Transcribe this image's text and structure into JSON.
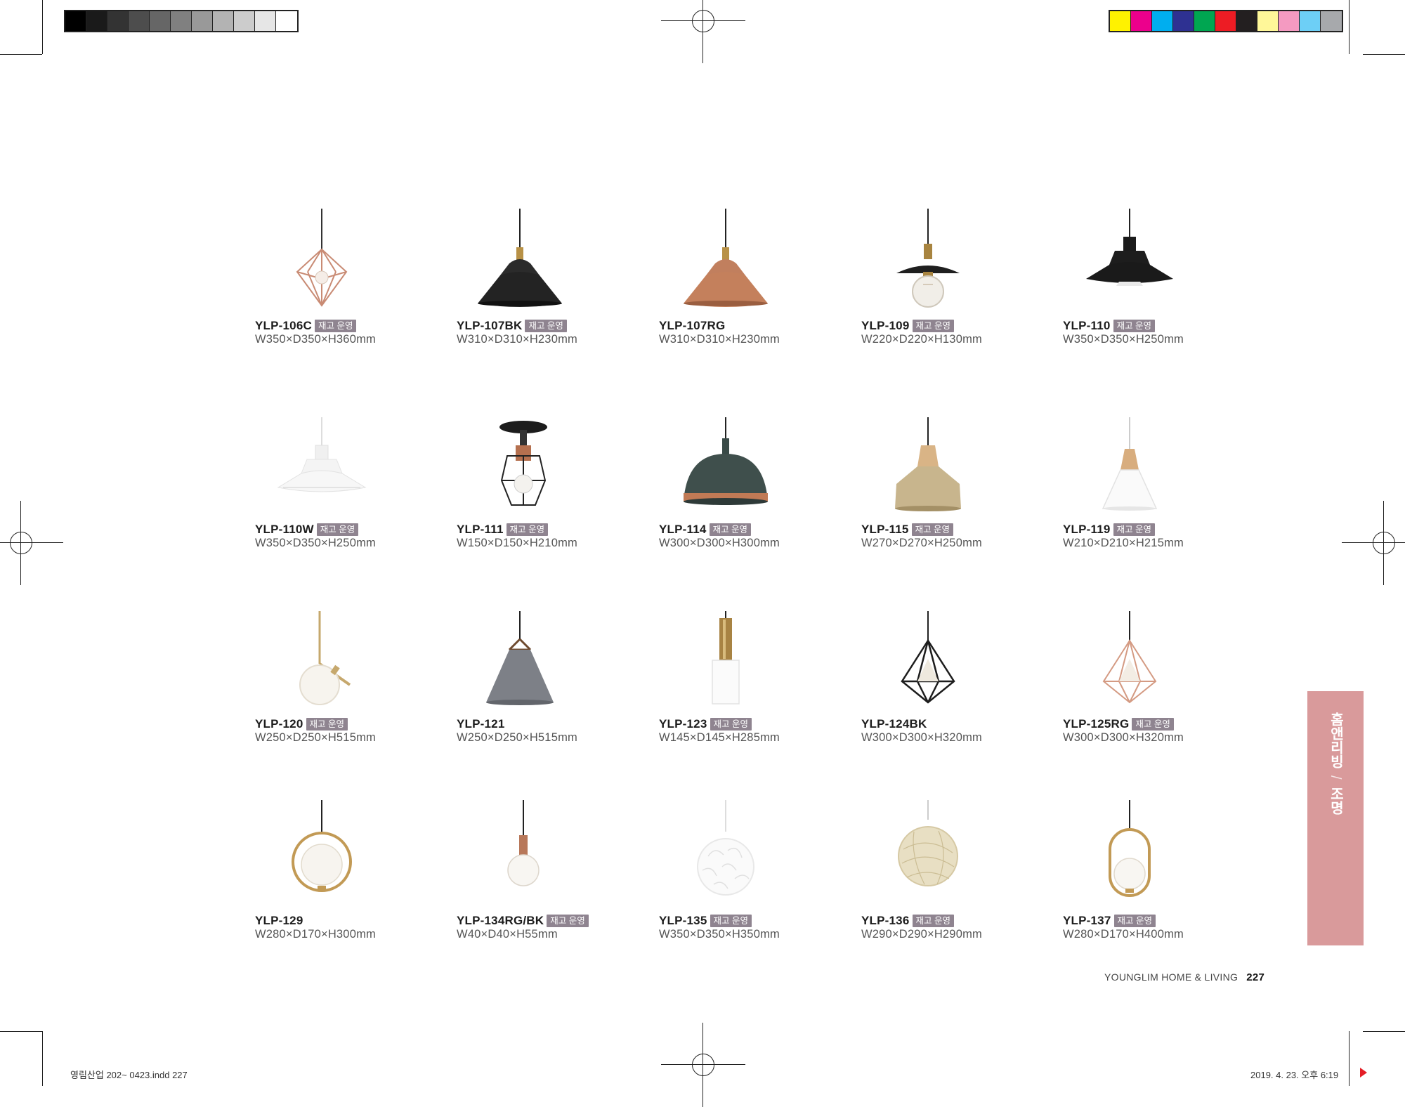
{
  "products": [
    {
      "code": "YLP-106C",
      "badge": "재고 운영",
      "dims": "W350×D350×H360mm",
      "icon": "geometric-cage-pendant-icon"
    },
    {
      "code": "YLP-107BK",
      "badge": "재고 운영",
      "dims": "W310×D310×H230mm",
      "icon": "black-dome-pendant-icon"
    },
    {
      "code": "YLP-107RG",
      "badge": "",
      "dims": "W310×D310×H230mm",
      "icon": "copper-dome-pendant-icon"
    },
    {
      "code": "YLP-109",
      "badge": "재고 운영",
      "dims": "W220×D220×H130mm",
      "icon": "flat-shade-bulb-pendant-icon"
    },
    {
      "code": "YLP-110",
      "badge": "재고 운영",
      "dims": "W350×D350×H250mm",
      "icon": "black-tiered-pendant-icon"
    },
    {
      "code": "YLP-110W",
      "badge": "재고 운영",
      "dims": "W350×D350×H250mm",
      "icon": "white-tiered-pendant-icon"
    },
    {
      "code": "YLP-111",
      "badge": "재고 운영",
      "dims": "W150×D150×H210mm",
      "icon": "cage-ceiling-lamp-icon"
    },
    {
      "code": "YLP-114",
      "badge": "재고 운영",
      "dims": "W300×D300×H300mm",
      "icon": "green-dome-pendant-icon"
    },
    {
      "code": "YLP-115",
      "badge": "재고 운영",
      "dims": "W270×D270×H250mm",
      "icon": "gold-cone-pendant-icon"
    },
    {
      "code": "YLP-119",
      "badge": "재고 운영",
      "dims": "W210×D210×H215mm",
      "icon": "white-cone-pendant-icon"
    },
    {
      "code": "YLP-120",
      "badge": "재고 운영",
      "dims": "W250×D250×H515mm",
      "icon": "glass-globe-arm-pendant-icon"
    },
    {
      "code": "YLP-121",
      "badge": "",
      "dims": "W250×D250×H515mm",
      "icon": "grey-triangle-pendant-icon"
    },
    {
      "code": "YLP-123",
      "badge": "재고 운영",
      "dims": "W145×D145×H285mm",
      "icon": "gold-white-cylinder-pendant-icon"
    },
    {
      "code": "YLP-124BK",
      "badge": "",
      "dims": "W300×D300×H320mm",
      "icon": "black-diamond-pendant-icon"
    },
    {
      "code": "YLP-125RG",
      "badge": "재고 운영",
      "dims": "W300×D300×H320mm",
      "icon": "rosegold-diamond-pendant-icon"
    },
    {
      "code": "YLP-129",
      "badge": "",
      "dims": "W280×D170×H300mm",
      "icon": "ring-globe-pendant-icon"
    },
    {
      "code": "YLP-134RG/BK",
      "badge": "재고 운영",
      "dims": "W40×D40×H55mm",
      "icon": "bare-bulb-pendant-icon"
    },
    {
      "code": "YLP-135",
      "badge": "재고 운영",
      "dims": "W350×D350×H350mm",
      "icon": "petal-ball-pendant-icon"
    },
    {
      "code": "YLP-136",
      "badge": "재고 운영",
      "dims": "W290×D290×H290mm",
      "icon": "rattan-ball-pendant-icon"
    },
    {
      "code": "YLP-137",
      "badge": "재고 운영",
      "dims": "W280×D170×H400mm",
      "icon": "oval-ring-globe-pendant-icon"
    }
  ],
  "side_tab": {
    "part1": "홈앤리빙",
    "separator": "/",
    "part2": "조명",
    "color": "#d99a9b"
  },
  "footer": {
    "brand": "YOUNGLIM HOME & LIVING",
    "page": "227"
  },
  "slug": {
    "file": "영림산업 202~ 0423.indd   227",
    "date": "2019. 4. 23.   오후 6:19"
  },
  "colors": {
    "gray_bar": [
      "#000000",
      "#1a1a1a",
      "#333333",
      "#4d4d4d",
      "#666666",
      "#808080",
      "#999999",
      "#b3b3b3",
      "#cccccc",
      "#e6e6e6",
      "#ffffff"
    ],
    "color_bar": [
      "#fff200",
      "#ec008c",
      "#00aeef",
      "#2e3192",
      "#00a651",
      "#ed1c24",
      "#231f20",
      "#fff799",
      "#f49ac1",
      "#6dcff6",
      "#a7a9ac"
    ]
  }
}
